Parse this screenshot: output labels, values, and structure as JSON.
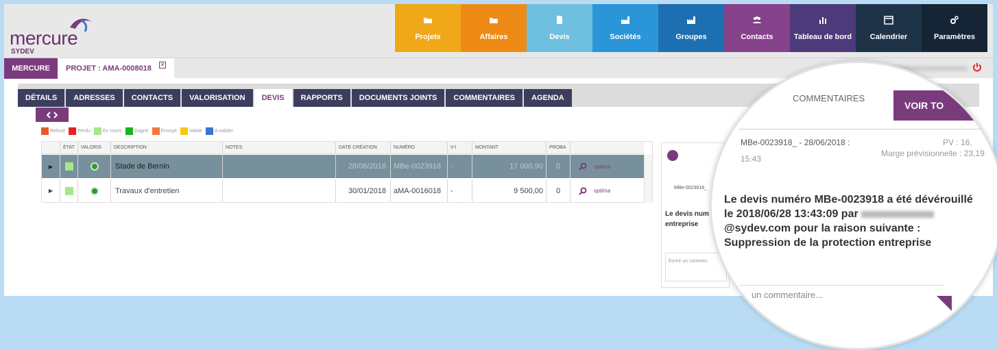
{
  "logo": {
    "word": "mercure",
    "sub": "SYDEV"
  },
  "nav": [
    {
      "label": "Projets",
      "icon": "folder-icon",
      "color": "#f0a818"
    },
    {
      "label": "Affaires",
      "icon": "folder-icon",
      "color": "#ee8a16"
    },
    {
      "label": "Devis",
      "icon": "document-icon",
      "color": "#6fbfe0"
    },
    {
      "label": "Sociétés",
      "icon": "factory-icon",
      "color": "#2a95d8"
    },
    {
      "label": "Groupes",
      "icon": "factory-icon",
      "color": "#1c6fb0"
    },
    {
      "label": "Contacts",
      "icon": "users-icon",
      "color": "#86428a"
    },
    {
      "label": "Tableau de bord",
      "icon": "chart-icon",
      "color": "#4c3a7a"
    },
    {
      "label": "Calendrier",
      "icon": "calendar-icon",
      "color": "#1e3348"
    },
    {
      "label": "Paramètres",
      "icon": "gears-icon",
      "color": "#152536"
    }
  ],
  "project_bar": {
    "mercure": "MERCURE",
    "projet": "PROJET : AMA-0008018",
    "close": "✕"
  },
  "tabs": [
    "DÉTAILS",
    "ADRESSES",
    "CONTACTS",
    "VALORISATION",
    "DEVIS",
    "RAPPORTS",
    "DOCUMENTS JOINTS",
    "COMMENTAIRES",
    "AGENDA"
  ],
  "active_tab": "DEVIS",
  "legend": [
    {
      "label": "Refusé",
      "color": "#e8572a"
    },
    {
      "label": "Perdu",
      "color": "#e82020"
    },
    {
      "label": "En cours",
      "color": "#a8e68a"
    },
    {
      "label": "Gagné",
      "color": "#20b020"
    },
    {
      "label": "Envoyé",
      "color": "#f07a3a"
    },
    {
      "label": "Validé",
      "color": "#f6c916"
    },
    {
      "label": "A valider",
      "color": "#3a74d0"
    }
  ],
  "table": {
    "headers": {
      "etat": "ÉTAT",
      "valoris": "VALORIS",
      "description": "DESCRIPTION",
      "notes": "NOTES",
      "date": "DATE CRÉATION",
      "numero": "NUMÉRO",
      "v": "V-I",
      "montant": "MONTANT",
      "proba": "PROBA"
    },
    "rows": [
      {
        "description": "Stade de Bernin",
        "date": "28/06/2018",
        "numero": "MBe-0023918",
        "v": "-",
        "montant": "17 000,90",
        "proba": "0"
      },
      {
        "description": "Travaux d'entretien",
        "date": "30/01/2018",
        "numero": "aMA-0016018",
        "v": "-",
        "montant": "9 500,00",
        "proba": "0"
      }
    ],
    "optima": "optima"
  },
  "panel": {
    "id": "MBe-0023918_",
    "text": "Le devis num entreprise",
    "input_placeholder": "Ecrire un commen"
  },
  "magnifier": {
    "title": "COMMENTAIRES",
    "button": "VOIR TO",
    "ref": "MBe-0023918_ - 28/06/2018 :",
    "time": "15:43",
    "pv": "PV : 16,",
    "marge": "Marge prévisionnelle : 23,19",
    "text_a": "Le devis numéro MBe-0023918 a été dévérouillé le 2018/06/28 13:43:09 par ",
    "text_b": "@sydev.com pour la raison suivante : Suppression de la protection entreprise",
    "input_placeholder": "un commentaire..."
  }
}
